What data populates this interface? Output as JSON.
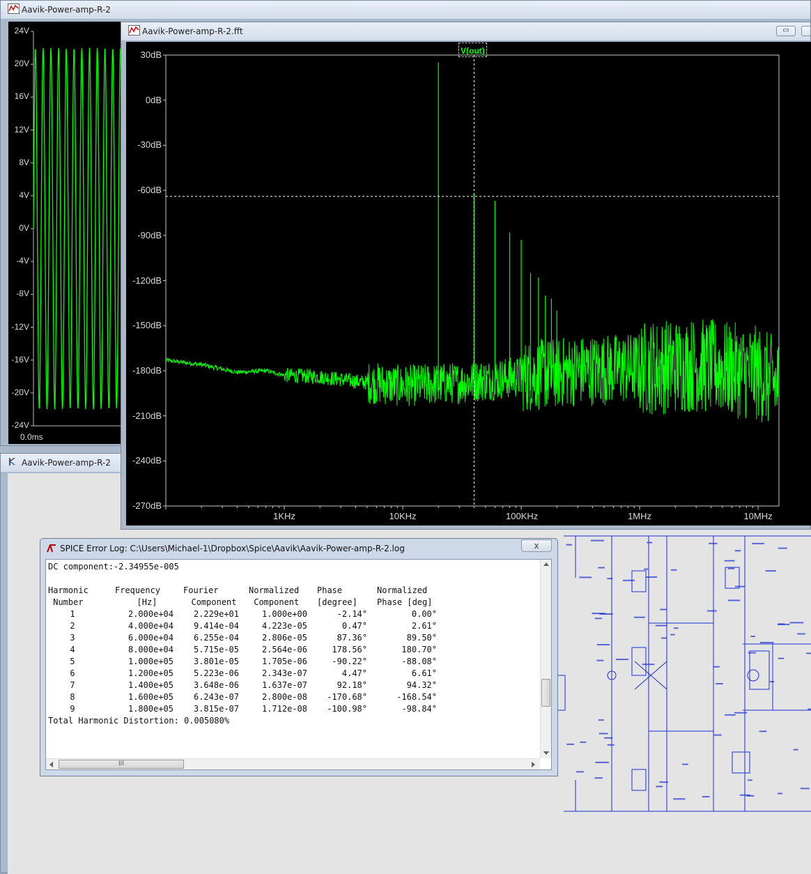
{
  "waveform_window": {
    "title": "Aavik-Power-amp-R-2",
    "y_ticks": [
      "24V",
      "20V",
      "16V",
      "12V",
      "8V",
      "4V",
      "0V",
      "-4V",
      "-8V",
      "-12V",
      "-16V",
      "-20V",
      "-24V"
    ],
    "x_tick": "0.0ms",
    "trace_color": "#00ff00"
  },
  "schematic_window": {
    "title": "Aavik-Power-amp-R-2"
  },
  "fft_window": {
    "title": "Aavik-Power-amp-R-2.fft",
    "trace_label": "V(out)",
    "minimize_label": "▭",
    "trace_color": "#00ff00"
  },
  "chart_data": {
    "type": "line",
    "series": [
      {
        "name": "V(out)",
        "color": "#00ff00"
      }
    ],
    "x_scale": "log",
    "xlim": [
      100,
      15000000
    ],
    "ylim": [
      -270,
      30
    ],
    "x_ticks": [
      {
        "value": 1000,
        "label": "1KHz"
      },
      {
        "value": 10000,
        "label": "10KHz"
      },
      {
        "value": 100000,
        "label": "100KHz"
      },
      {
        "value": 1000000,
        "label": "1MHz"
      },
      {
        "value": 10000000,
        "label": "10MHz"
      }
    ],
    "y_ticks": [
      {
        "value": 30,
        "label": "30dB"
      },
      {
        "value": 0,
        "label": "0dB"
      },
      {
        "value": -30,
        "label": "-30dB"
      },
      {
        "value": -60,
        "label": "-60dB"
      },
      {
        "value": -90,
        "label": "-90dB"
      },
      {
        "value": -120,
        "label": "-120dB"
      },
      {
        "value": -150,
        "label": "-150dB"
      },
      {
        "value": -180,
        "label": "-180dB"
      },
      {
        "value": -210,
        "label": "-210dB"
      },
      {
        "value": -240,
        "label": "-240dB"
      },
      {
        "value": -270,
        "label": "-270dB"
      }
    ],
    "cursor": {
      "x": 40000,
      "y": -64
    },
    "harmonic_peaks": [
      {
        "freq": 20000,
        "db": 25
      },
      {
        "freq": 40000,
        "db": -62
      },
      {
        "freq": 60000,
        "db": -67
      },
      {
        "freq": 80000,
        "db": -88
      },
      {
        "freq": 100000,
        "db": -93
      },
      {
        "freq": 120000,
        "db": -115
      },
      {
        "freq": 140000,
        "db": -118
      },
      {
        "freq": 160000,
        "db": -130
      },
      {
        "freq": 180000,
        "db": -132
      },
      {
        "freq": 200000,
        "db": -140
      }
    ],
    "noise_floor": [
      {
        "freq": 100,
        "db": -173
      },
      {
        "freq": 200,
        "db": -176
      },
      {
        "freq": 400,
        "db": -181
      },
      {
        "freq": 700,
        "db": -180
      },
      {
        "freq": 1000,
        "db": -183
      },
      {
        "freq": 2000,
        "db": -184
      },
      {
        "freq": 5000,
        "db": -188
      },
      {
        "freq": 10000,
        "db": -190
      },
      {
        "freq": 30000,
        "db": -188
      },
      {
        "freq": 100000,
        "db": -184
      },
      {
        "freq": 300000,
        "db": -180
      },
      {
        "freq": 1000000,
        "db": -178
      },
      {
        "freq": 3000000,
        "db": -176
      },
      {
        "freq": 10000000,
        "db": -182
      },
      {
        "freq": 15000000,
        "db": -190
      }
    ]
  },
  "error_log": {
    "title": "SPICE Error Log: C:\\Users\\Michael-1\\Dropbox\\Spice\\Aavik\\Aavik-Power-amp-R-2.log",
    "close_label": "x",
    "dc_line": "DC component:-2.34955e-005",
    "headers1": [
      "Harmonic",
      "Frequency",
      "Fourier",
      "Normalized",
      "Phase",
      "Normalized"
    ],
    "headers2": [
      " Number",
      "[Hz]",
      "Component",
      " Component",
      "[degree]",
      "Phase [deg]"
    ],
    "rows": [
      [
        "1",
        "2.000e+04",
        "2.229e+01",
        "1.000e+00",
        "-2.14°",
        "0.00°"
      ],
      [
        "2",
        "4.000e+04",
        "9.414e-04",
        "4.223e-05",
        "0.47°",
        "2.61°"
      ],
      [
        "3",
        "6.000e+04",
        "6.255e-04",
        "2.806e-05",
        "87.36°",
        "89.50°"
      ],
      [
        "4",
        "8.000e+04",
        "5.715e-05",
        "2.564e-06",
        "178.56°",
        "180.70°"
      ],
      [
        "5",
        "1.000e+05",
        "3.801e-05",
        "1.705e-06",
        "-90.22°",
        "-88.08°"
      ],
      [
        "6",
        "1.200e+05",
        "5.223e-06",
        "2.343e-07",
        "4.47°",
        "6.61°"
      ],
      [
        "7",
        "1.400e+05",
        "3.648e-06",
        "1.637e-07",
        "92.18°",
        "94.32°"
      ],
      [
        "8",
        "1.600e+05",
        "6.243e-07",
        "2.800e-08",
        "-170.68°",
        "-168.54°"
      ],
      [
        "9",
        "1.800e+05",
        "3.815e-07",
        "1.712e-08",
        "-100.98°",
        "-98.84°"
      ]
    ],
    "thd_line": "Total Harmonic Distortion: 0.005080%",
    "scroll_grip": "III"
  }
}
